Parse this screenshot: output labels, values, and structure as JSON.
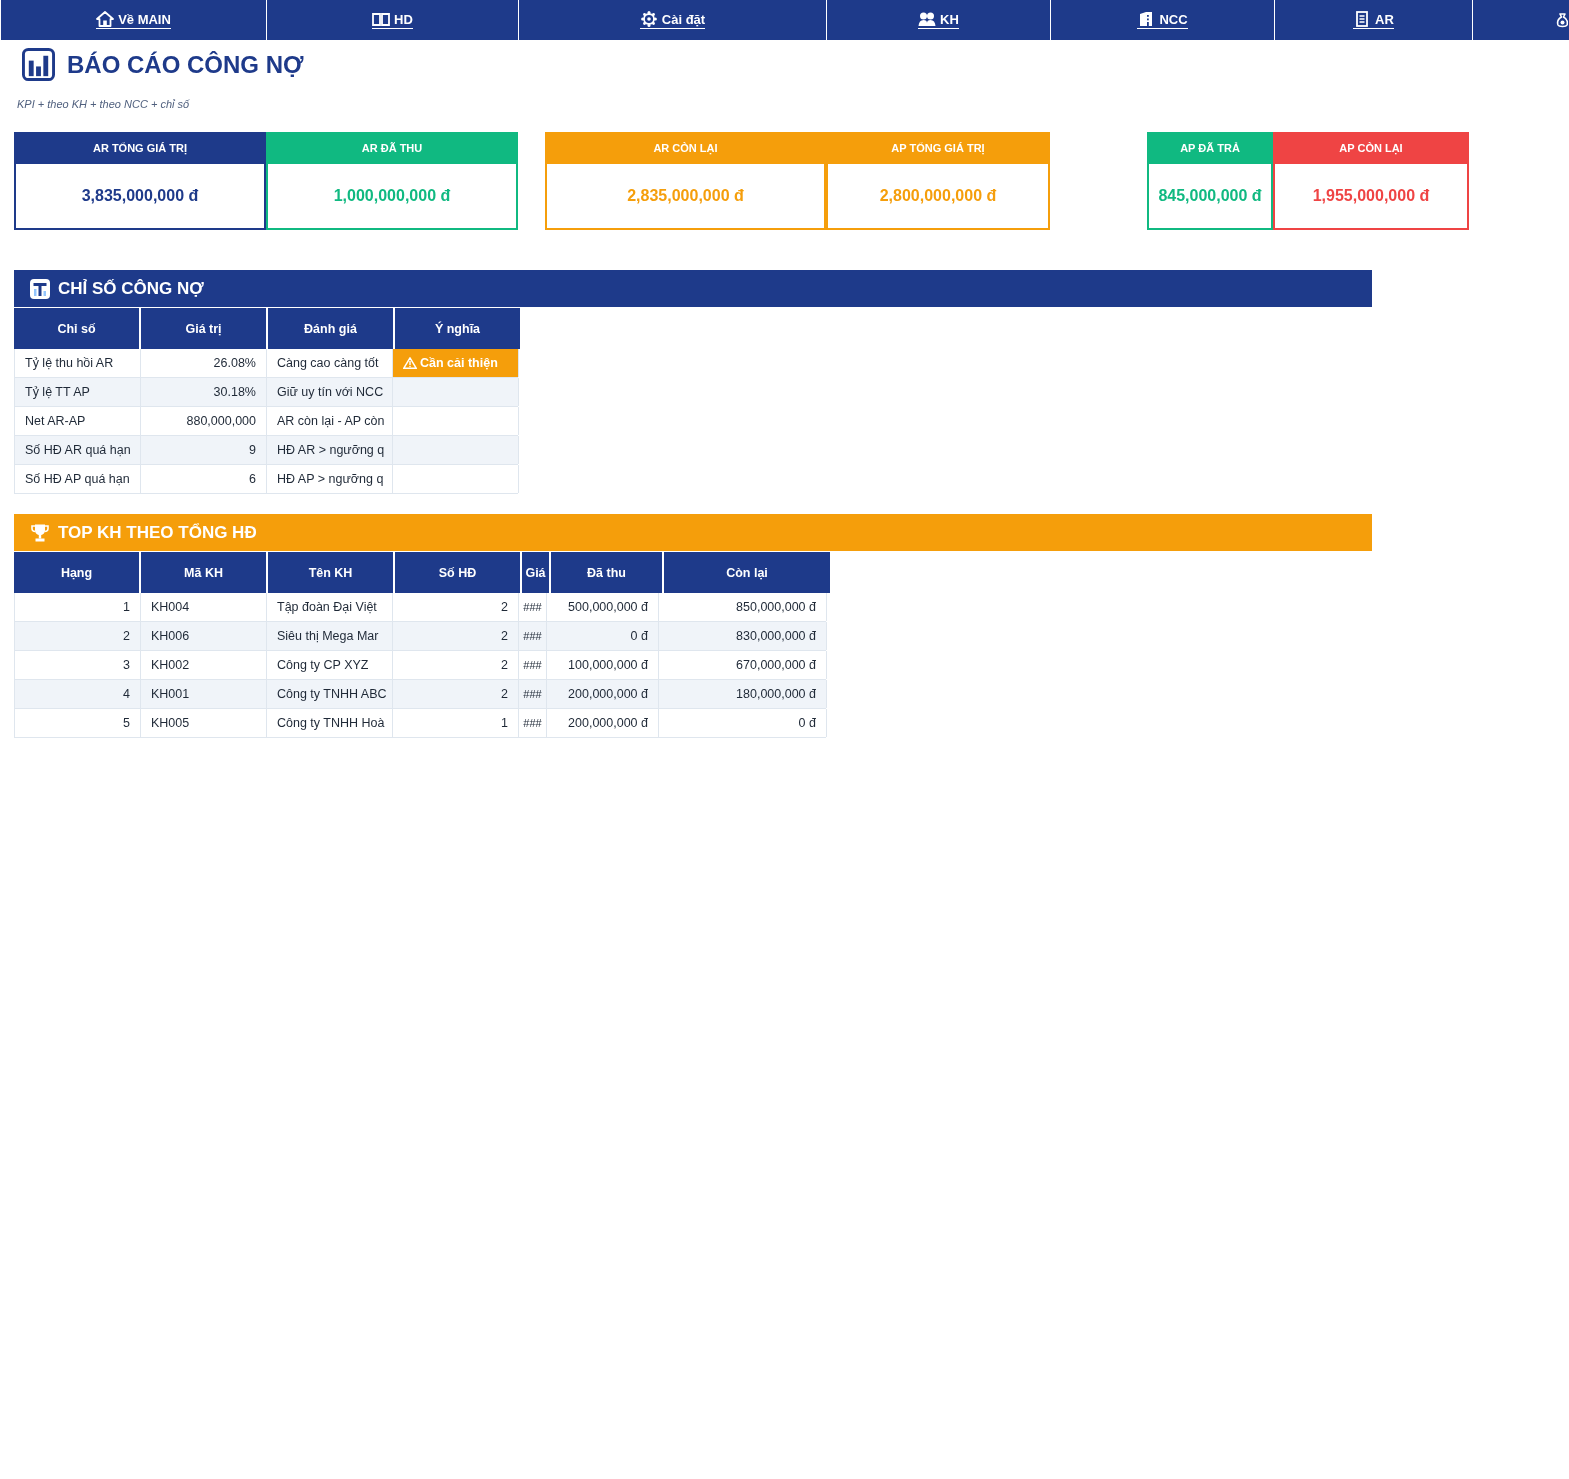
{
  "nav": {
    "items": [
      {
        "kind": "link",
        "label": "Về MAIN"
      },
      {
        "kind": "link",
        "label": "HD"
      },
      {
        "kind": "link",
        "label": "Cài đặt"
      },
      {
        "kind": "link",
        "label": "KH"
      },
      {
        "kind": "link",
        "label": "NCC"
      },
      {
        "kind": "link",
        "label": "AR"
      },
      {
        "kind": "icon_only"
      }
    ]
  },
  "header": {
    "title": "BÁO CÁO CÔNG NỢ",
    "subtitle": "KPI + theo KH + theo NCC + chỉ số"
  },
  "kpi_groups": [
    {
      "cards": [
        {
          "label": "AR TỔNG GIÁ TRỊ",
          "value": "3,835,000,000 đ",
          "color": "#1e3a8a"
        },
        {
          "label": "AR ĐÃ THU",
          "value": "1,000,000,000 đ",
          "color": "#10b981"
        }
      ]
    },
    {
      "cards": [
        {
          "label": "AR CÒN LẠI",
          "value": "2,835,000,000 đ",
          "color": "#f59e0b"
        },
        {
          "label": "AP TỔNG GIÁ TRỊ",
          "value": "2,800,000,000 đ",
          "color": "#f59e0b"
        }
      ]
    },
    {
      "cards": [
        {
          "label": "AP ĐÃ TRẢ",
          "value": "845,000,000 đ",
          "color": "#10b981"
        },
        {
          "label": "AP CÒN LẠI",
          "value": "1,955,000,000 đ",
          "color": "#ef4444"
        }
      ]
    }
  ],
  "indicators": {
    "title": "CHỈ SỐ CÔNG NỢ",
    "columns": [
      "Chỉ số",
      "Giá trị",
      "Đánh giá",
      "Ý nghĩa"
    ],
    "rows": [
      {
        "cells": [
          "Tỷ lệ thu hồi AR",
          "26.08%",
          "Càng cao càng tốt"
        ],
        "status": {
          "kind": "warning",
          "label": "Cần cải thiện"
        }
      },
      {
        "cells": [
          "Tỷ lệ TT AP",
          "30.18%",
          "Giữ uy tín với NCC"
        ]
      },
      {
        "cells": [
          "Net AR-AP",
          "880,000,000",
          "AR còn lại - AP còn"
        ]
      },
      {
        "cells": [
          "Số HĐ AR quá hạn",
          "9",
          "HĐ AR > ngưỡng q"
        ]
      },
      {
        "cells": [
          "Số HĐ AP quá hạn",
          "6",
          "HĐ AP > ngưỡng q"
        ]
      }
    ]
  },
  "top_customers": {
    "title": "TOP KH THEO TỔNG HĐ",
    "columns": [
      "Hạng",
      "Mã KH",
      "Tên KH",
      "Số HĐ",
      "Giá",
      "Đã thu",
      "Còn lại"
    ],
    "rows": [
      [
        "1",
        "KH004",
        "Tập đoàn Đại Việt",
        "2",
        "###",
        "500,000,000 đ",
        "850,000,000 đ"
      ],
      [
        "2",
        "KH006",
        "Siêu thị Mega Mar",
        "2",
        "###",
        "0 đ",
        "830,000,000 đ"
      ],
      [
        "3",
        "KH002",
        "Công ty CP XYZ",
        "2",
        "###",
        "100,000,000 đ",
        "670,000,000 đ"
      ],
      [
        "4",
        "KH001",
        "Công ty TNHH ABC",
        "2",
        "###",
        "200,000,000 đ",
        "180,000,000 đ"
      ],
      [
        "5",
        "KH005",
        "Công ty TNHH Hoà",
        "1",
        "###",
        "200,000,000 đ",
        "0 đ"
      ]
    ]
  }
}
